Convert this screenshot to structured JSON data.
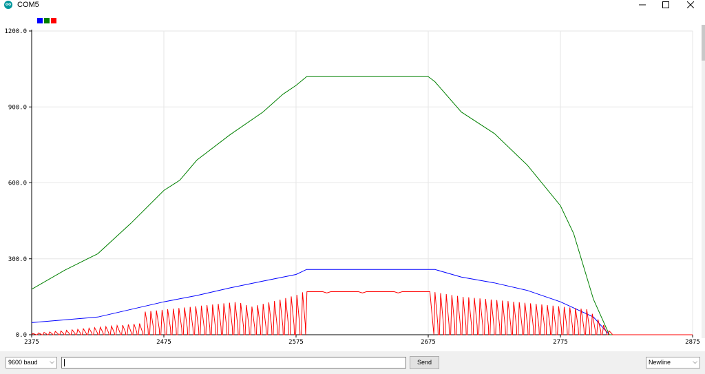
{
  "window": {
    "title": "COM5",
    "icon": "arduino-icon",
    "controls": [
      "minimize-icon",
      "maximize-icon",
      "close-icon"
    ]
  },
  "toolbar": {
    "baud_label": "9600 baud",
    "input_value": "",
    "send_label": "Send",
    "line_ending_label": "Newline"
  },
  "chart_data": {
    "type": "line",
    "ylim": [
      0,
      1200
    ],
    "xlim": [
      2375,
      2875
    ],
    "y_ticks": [
      "0.0",
      "300.0",
      "600.0",
      "900.0",
      "1200.0"
    ],
    "x_ticks": [
      "2375",
      "2475",
      "2575",
      "2675",
      "2775",
      "2875"
    ],
    "grid": true,
    "legend": "top-left",
    "series": [
      {
        "color": "#0000ff",
        "x": [
          2375,
          2425,
          2475,
          2500,
          2525,
          2550,
          2575,
          2583,
          2600,
          2625,
          2650,
          2675,
          2680,
          2700,
          2725,
          2750,
          2775,
          2800,
          2812,
          2875
        ],
        "values": [
          48,
          70,
          130,
          155,
          185,
          212,
          238,
          258,
          258,
          258,
          258,
          258,
          258,
          228,
          205,
          175,
          130,
          70,
          0,
          0
        ]
      },
      {
        "color": "#008000",
        "x": [
          2375,
          2400,
          2425,
          2450,
          2475,
          2487,
          2500,
          2525,
          2550,
          2565,
          2575,
          2583,
          2600,
          2625,
          2650,
          2675,
          2680,
          2700,
          2725,
          2750,
          2775,
          2785,
          2800,
          2812,
          2875
        ],
        "values": [
          180,
          255,
          320,
          440,
          570,
          610,
          690,
          790,
          880,
          950,
          985,
          1020,
          1020,
          1020,
          1020,
          1020,
          1000,
          880,
          795,
          670,
          510,
          400,
          140,
          0,
          0
        ]
      },
      {
        "color": "#ff0000",
        "x_start": 2375,
        "x_end": 2812,
        "plateau": [
          2580,
          2677
        ],
        "plateau_value": 170,
        "envelope": [
          [
            2375,
            5
          ],
          [
            2457,
            45
          ],
          [
            2458,
            90
          ],
          [
            2530,
            130
          ],
          [
            2540,
            110
          ],
          [
            2563,
            140
          ],
          [
            2575,
            158
          ],
          [
            2580,
            170
          ],
          [
            2677,
            170
          ],
          [
            2700,
            150
          ],
          [
            2750,
            125
          ],
          [
            2795,
            100
          ],
          [
            2812,
            10
          ]
        ]
      }
    ]
  }
}
